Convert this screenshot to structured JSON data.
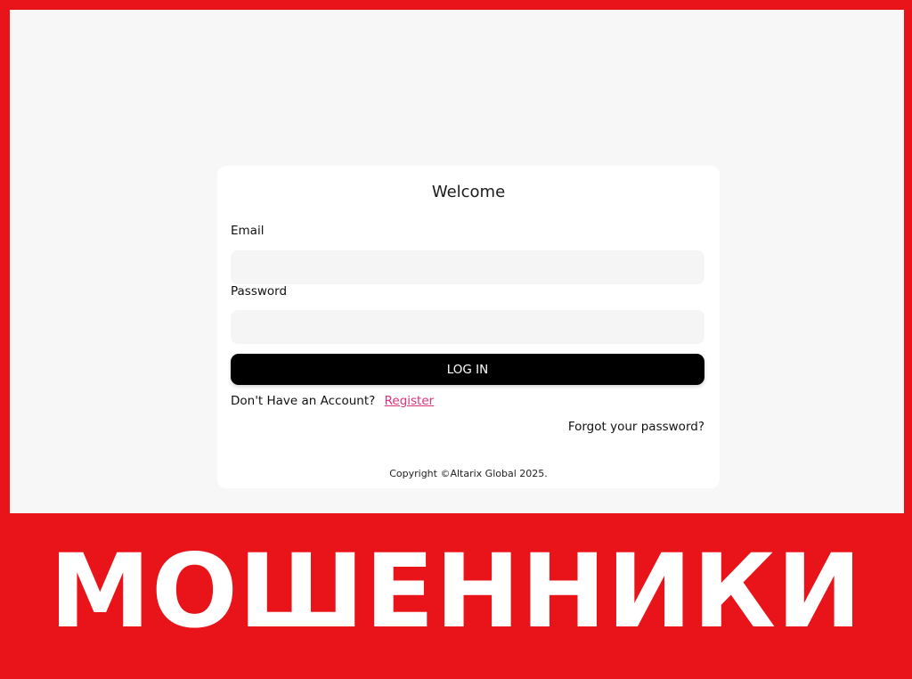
{
  "login": {
    "title": "Welcome",
    "email_label": "Email",
    "email_value": "",
    "password_label": "Password",
    "password_value": "",
    "login_button": "LOG IN",
    "account_prompt": "Don't Have an Account?",
    "register_link": "Register",
    "forgot_link": "Forgot your password?",
    "copyright": "Copyright ©Altarix Global 2025."
  },
  "banner": {
    "text": "МОШЕННИКИ"
  },
  "colors": {
    "banner_red": "#e8141a",
    "page_background": "#f7f7f7",
    "card_background": "#ffffff",
    "input_background": "#f5f5f5",
    "button_background": "#000000",
    "link": "#d8337c"
  }
}
